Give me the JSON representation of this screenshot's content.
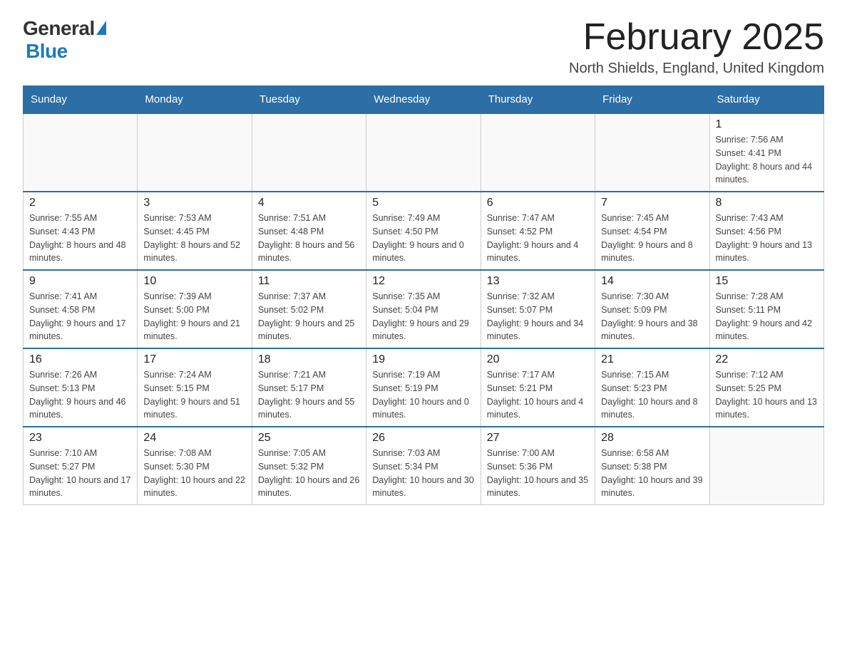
{
  "header": {
    "logo": {
      "general_text": "General",
      "blue_text": "Blue"
    },
    "title": "February 2025",
    "subtitle": "North Shields, England, United Kingdom"
  },
  "weekdays": [
    "Sunday",
    "Monday",
    "Tuesday",
    "Wednesday",
    "Thursday",
    "Friday",
    "Saturday"
  ],
  "weeks": [
    [
      {
        "day": "",
        "info": ""
      },
      {
        "day": "",
        "info": ""
      },
      {
        "day": "",
        "info": ""
      },
      {
        "day": "",
        "info": ""
      },
      {
        "day": "",
        "info": ""
      },
      {
        "day": "",
        "info": ""
      },
      {
        "day": "1",
        "info": "Sunrise: 7:56 AM\nSunset: 4:41 PM\nDaylight: 8 hours and 44 minutes."
      }
    ],
    [
      {
        "day": "2",
        "info": "Sunrise: 7:55 AM\nSunset: 4:43 PM\nDaylight: 8 hours and 48 minutes."
      },
      {
        "day": "3",
        "info": "Sunrise: 7:53 AM\nSunset: 4:45 PM\nDaylight: 8 hours and 52 minutes."
      },
      {
        "day": "4",
        "info": "Sunrise: 7:51 AM\nSunset: 4:48 PM\nDaylight: 8 hours and 56 minutes."
      },
      {
        "day": "5",
        "info": "Sunrise: 7:49 AM\nSunset: 4:50 PM\nDaylight: 9 hours and 0 minutes."
      },
      {
        "day": "6",
        "info": "Sunrise: 7:47 AM\nSunset: 4:52 PM\nDaylight: 9 hours and 4 minutes."
      },
      {
        "day": "7",
        "info": "Sunrise: 7:45 AM\nSunset: 4:54 PM\nDaylight: 9 hours and 8 minutes."
      },
      {
        "day": "8",
        "info": "Sunrise: 7:43 AM\nSunset: 4:56 PM\nDaylight: 9 hours and 13 minutes."
      }
    ],
    [
      {
        "day": "9",
        "info": "Sunrise: 7:41 AM\nSunset: 4:58 PM\nDaylight: 9 hours and 17 minutes."
      },
      {
        "day": "10",
        "info": "Sunrise: 7:39 AM\nSunset: 5:00 PM\nDaylight: 9 hours and 21 minutes."
      },
      {
        "day": "11",
        "info": "Sunrise: 7:37 AM\nSunset: 5:02 PM\nDaylight: 9 hours and 25 minutes."
      },
      {
        "day": "12",
        "info": "Sunrise: 7:35 AM\nSunset: 5:04 PM\nDaylight: 9 hours and 29 minutes."
      },
      {
        "day": "13",
        "info": "Sunrise: 7:32 AM\nSunset: 5:07 PM\nDaylight: 9 hours and 34 minutes."
      },
      {
        "day": "14",
        "info": "Sunrise: 7:30 AM\nSunset: 5:09 PM\nDaylight: 9 hours and 38 minutes."
      },
      {
        "day": "15",
        "info": "Sunrise: 7:28 AM\nSunset: 5:11 PM\nDaylight: 9 hours and 42 minutes."
      }
    ],
    [
      {
        "day": "16",
        "info": "Sunrise: 7:26 AM\nSunset: 5:13 PM\nDaylight: 9 hours and 46 minutes."
      },
      {
        "day": "17",
        "info": "Sunrise: 7:24 AM\nSunset: 5:15 PM\nDaylight: 9 hours and 51 minutes."
      },
      {
        "day": "18",
        "info": "Sunrise: 7:21 AM\nSunset: 5:17 PM\nDaylight: 9 hours and 55 minutes."
      },
      {
        "day": "19",
        "info": "Sunrise: 7:19 AM\nSunset: 5:19 PM\nDaylight: 10 hours and 0 minutes."
      },
      {
        "day": "20",
        "info": "Sunrise: 7:17 AM\nSunset: 5:21 PM\nDaylight: 10 hours and 4 minutes."
      },
      {
        "day": "21",
        "info": "Sunrise: 7:15 AM\nSunset: 5:23 PM\nDaylight: 10 hours and 8 minutes."
      },
      {
        "day": "22",
        "info": "Sunrise: 7:12 AM\nSunset: 5:25 PM\nDaylight: 10 hours and 13 minutes."
      }
    ],
    [
      {
        "day": "23",
        "info": "Sunrise: 7:10 AM\nSunset: 5:27 PM\nDaylight: 10 hours and 17 minutes."
      },
      {
        "day": "24",
        "info": "Sunrise: 7:08 AM\nSunset: 5:30 PM\nDaylight: 10 hours and 22 minutes."
      },
      {
        "day": "25",
        "info": "Sunrise: 7:05 AM\nSunset: 5:32 PM\nDaylight: 10 hours and 26 minutes."
      },
      {
        "day": "26",
        "info": "Sunrise: 7:03 AM\nSunset: 5:34 PM\nDaylight: 10 hours and 30 minutes."
      },
      {
        "day": "27",
        "info": "Sunrise: 7:00 AM\nSunset: 5:36 PM\nDaylight: 10 hours and 35 minutes."
      },
      {
        "day": "28",
        "info": "Sunrise: 6:58 AM\nSunset: 5:38 PM\nDaylight: 10 hours and 39 minutes."
      },
      {
        "day": "",
        "info": ""
      }
    ]
  ]
}
